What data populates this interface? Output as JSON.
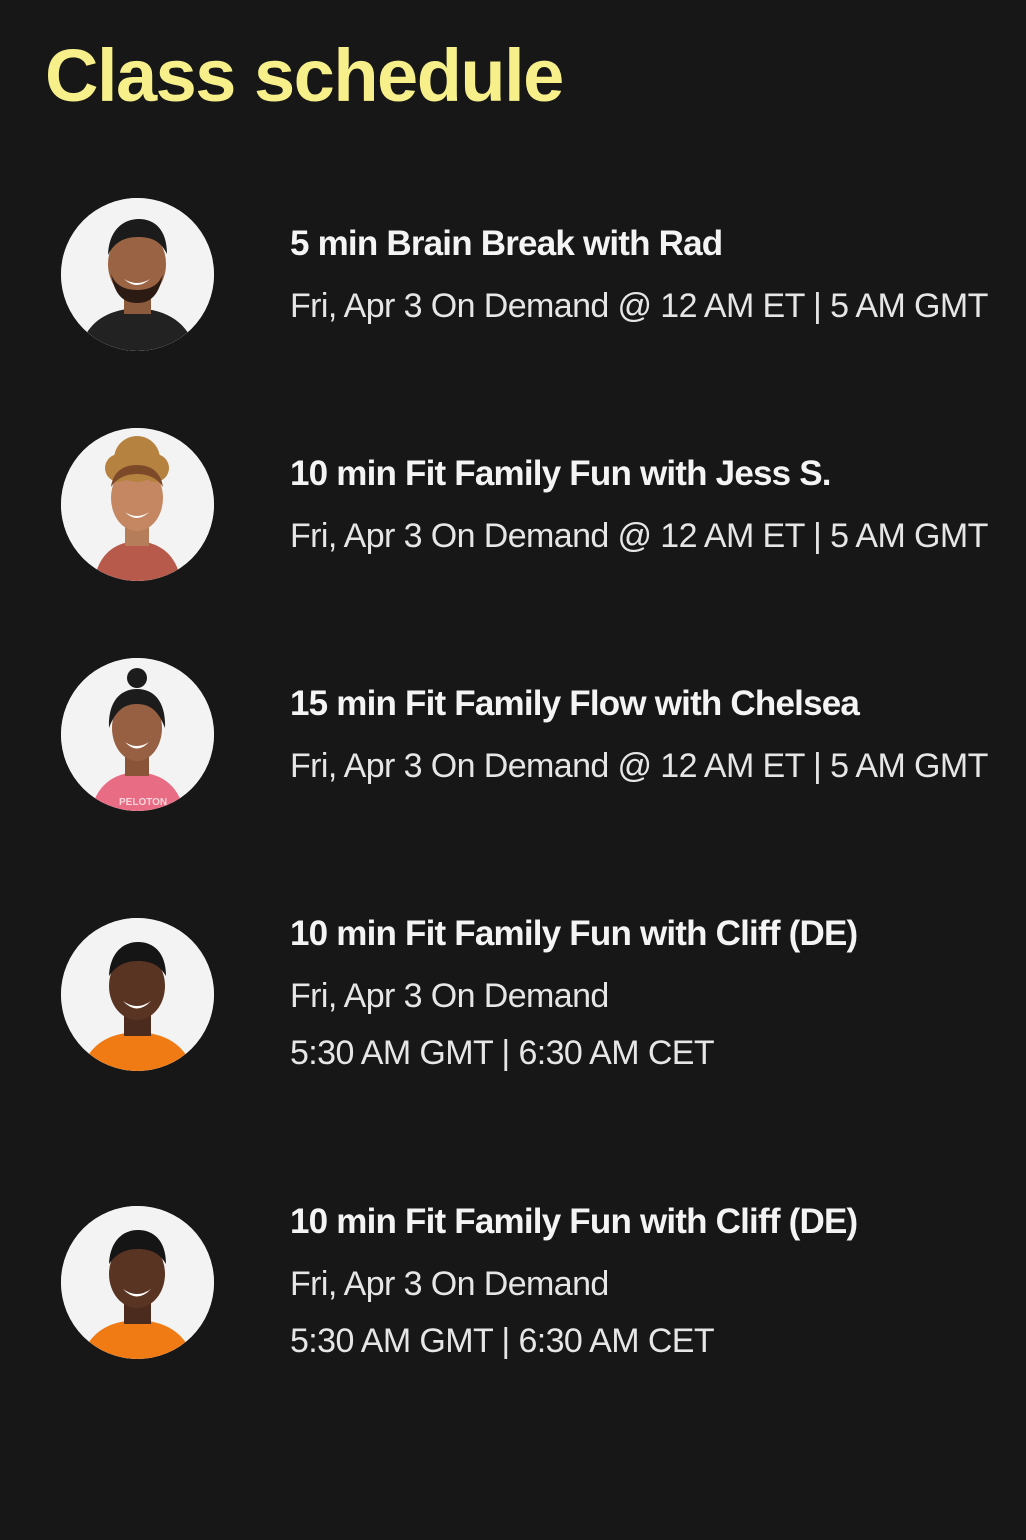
{
  "page": {
    "title": "Class schedule"
  },
  "classes": [
    {
      "title": "5 min Brain Break with Rad",
      "lines": [
        "Fri, Apr 3 On Demand @ 12 AM ET | 5 AM GMT"
      ],
      "instructor_icon": "instructor-rad-avatar"
    },
    {
      "title": "10 min Fit Family Fun with Jess S.",
      "lines": [
        "Fri, Apr 3 On Demand @ 12 AM ET | 5 AM GMT"
      ],
      "instructor_icon": "instructor-jess-avatar"
    },
    {
      "title": "15 min Fit Family Flow with Chelsea",
      "lines": [
        "Fri, Apr 3 On Demand @ 12 AM ET | 5 AM GMT"
      ],
      "instructor_icon": "instructor-chelsea-avatar",
      "shirt_text": "PELOTON"
    },
    {
      "title": "10 min Fit Family Fun with Cliff (DE)",
      "lines": [
        "Fri, Apr 3 On Demand",
        "5:30 AM GMT | 6:30 AM CET"
      ],
      "instructor_icon": "instructor-cliff-avatar"
    },
    {
      "title": "10 min Fit Family Fun with Cliff (DE)",
      "lines": [
        "Fri, Apr 3 On Demand",
        "5:30 AM GMT | 6:30 AM CET"
      ],
      "instructor_icon": "instructor-cliff-avatar"
    }
  ],
  "colors": {
    "background": "#171717",
    "title_accent": "#f7f08a",
    "text_primary": "#f4f4f4",
    "text_secondary": "#e6e6e6"
  }
}
